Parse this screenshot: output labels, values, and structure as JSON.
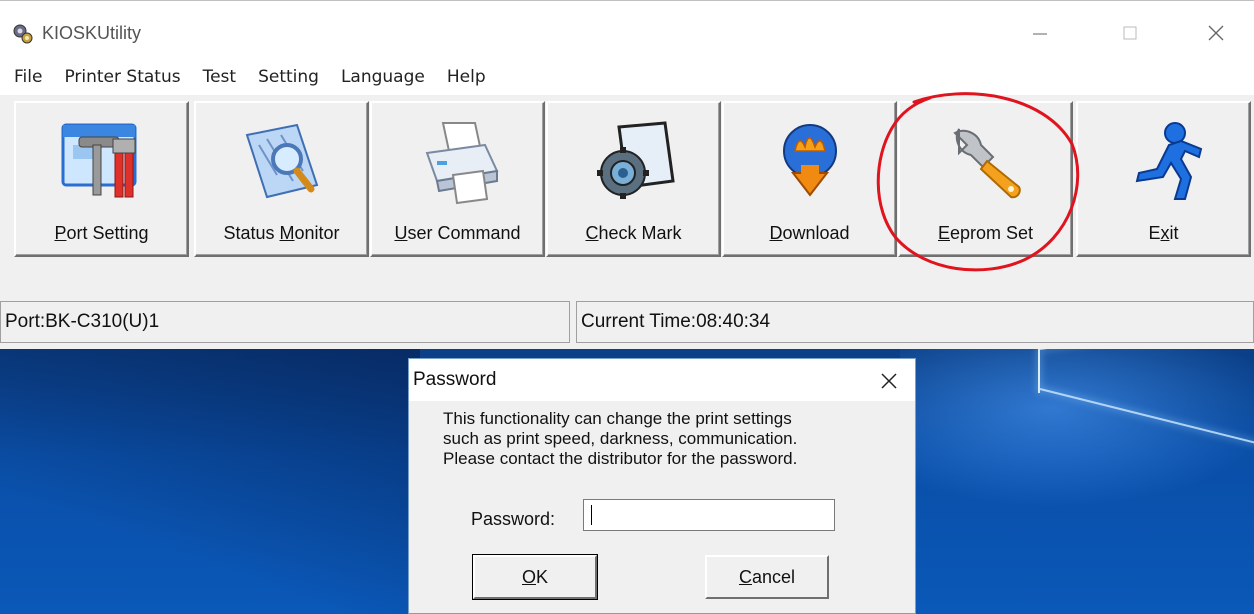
{
  "window": {
    "title": "KIOSKUtility",
    "controls": {
      "minimize": "—",
      "maximize": "☐",
      "close": "✕"
    }
  },
  "menu": [
    "File",
    "Printer Status",
    "Test",
    "Setting",
    "Language",
    "Help"
  ],
  "toolbar": {
    "buttons": [
      {
        "pre": "",
        "key": "P",
        "post": "ort Setting",
        "icon": "port-setting-icon"
      },
      {
        "pre": "Status ",
        "key": "M",
        "post": "onitor",
        "icon": "status-monitor-icon"
      },
      {
        "pre": "",
        "key": "U",
        "post": "ser Command",
        "icon": "printer-icon"
      },
      {
        "pre": "",
        "key": "C",
        "post": "heck Mark",
        "icon": "check-mark-icon"
      },
      {
        "pre": "",
        "key": "D",
        "post": "ownload",
        "icon": "download-icon"
      },
      {
        "pre": "",
        "key": "E",
        "post": "eprom Set",
        "icon": "wrench-icon"
      },
      {
        "pre": "E",
        "key": "x",
        "post": "it",
        "icon": "exit-runner-icon"
      }
    ]
  },
  "status": {
    "port": "Port:BK-C310(U)1",
    "time": "Current Time:08:40:34"
  },
  "dialog": {
    "title": "Password",
    "message": [
      "This functionality can change the print settings",
      "such as print speed, darkness, communication.",
      "Please contact the distributor for the password."
    ],
    "password_label": "Password:",
    "password_value": "",
    "ok_key": "O",
    "ok_rest": "K",
    "cancel_key": "C",
    "cancel_rest": "ancel"
  },
  "colors": {
    "annotation": "#e0141e",
    "desktop": "#0a4fa8"
  }
}
